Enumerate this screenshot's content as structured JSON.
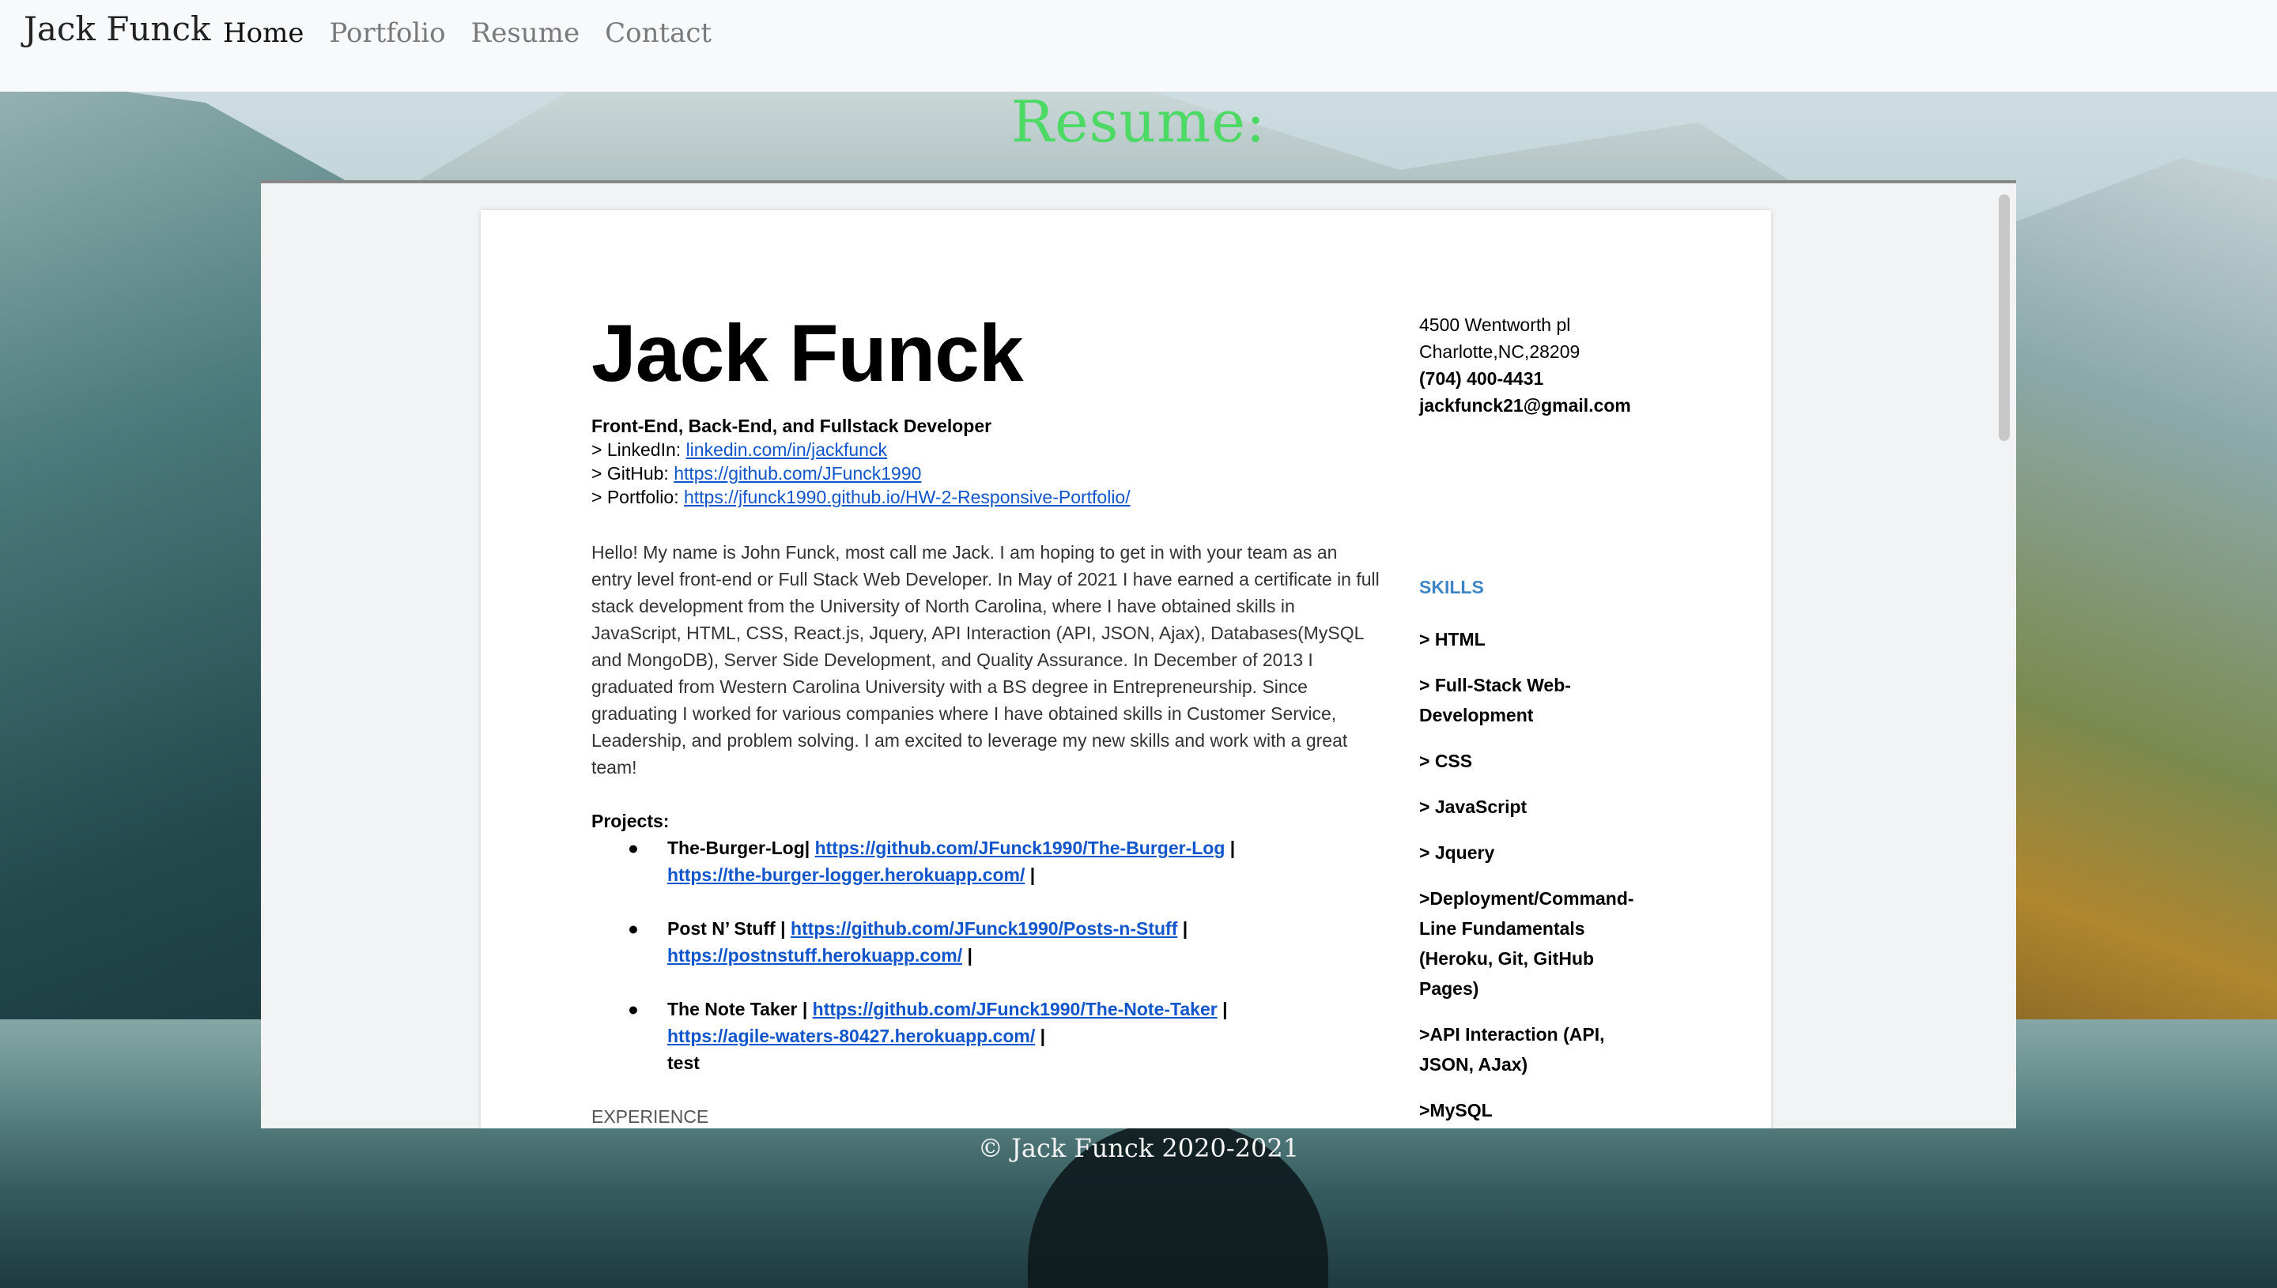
{
  "navbar": {
    "brand": "Jack Funck",
    "links": [
      "Home",
      "Portfolio",
      "Resume",
      "Contact"
    ]
  },
  "page_title": "Resume:",
  "resume": {
    "name": "Jack Funck",
    "tagline": "Front-End, Back-End, and Fullstack Developer",
    "linkedin_label": "> LinkedIn: ",
    "linkedin_url": "linkedin.com/in/jackfunck",
    "github_label": "> GitHub: ",
    "github_url": "https://github.com/JFunck1990",
    "portfolio_label": "> Portfolio: ",
    "portfolio_url": "https://jfunck1990.github.io/HW-2-Responsive-Portfolio/",
    "bio": "Hello! My name is John Funck, most call me Jack. I am hoping to get in with your team as an entry level  front-end or Full Stack  Web Developer. In May of 2021 I have earned a certificate in full stack development from the University of North Carolina, where I have obtained skills in JavaScript, HTML, CSS, React.js, Jquery, API Interaction (API, JSON, Ajax), Databases(MySQL and MongoDB), Server Side Development, and Quality Assurance.  In December of 2013 I graduated from Western Carolina University with a BS degree in Entrepreneurship. Since graduating I worked for various companies where I have obtained skills in Customer Service, Leadership, and problem solving. I am excited to leverage my new skills and work with a great team!",
    "projects_heading": "Projects:",
    "projects": [
      {
        "name": "The-Burger-Log|",
        "repo": "https://github.com/JFunck1990/The-Burger-Log",
        "sep1": "  |",
        "app": "https://the-burger-logger.herokuapp.com/",
        "sep2": " |",
        "extra": ""
      },
      {
        "name": "Post N’ Stuff  |",
        "repo": "https://github.com/JFunck1990/Posts-n-Stuff",
        "sep1": " |",
        "app": "https://postnstuff.herokuapp.com/",
        "sep2": " |",
        "extra": ""
      },
      {
        "name": "The Note Taker |",
        "repo": "https://github.com/JFunck1990/The-Note-Taker",
        "sep1": " |",
        "app": "https://agile-waters-80427.herokuapp.com/",
        "sep2": " |",
        "extra": "test"
      }
    ],
    "experience_heading": "EXPERIENCE",
    "address_line1": "4500 Wentworth pl",
    "address_line2": "Charlotte,NC,28209",
    "phone": "(704) 400-4431",
    "email": "jackfunck21@gmail.com",
    "skills_heading": "SKILLS",
    "skills": [
      "> HTML",
      "> Full-Stack Web-Development",
      "> CSS",
      "> JavaScript",
      "> Jquery",
      ">Deployment/Command-Line Fundamentals (Heroku, Git, GitHub Pages)",
      ">API Interaction (API, JSON, AJax)",
      ">MySQL"
    ]
  },
  "footer": "© Jack Funck 2020-2021",
  "colors": {
    "title_green": "#4cd964",
    "link_blue": "#1155cc",
    "skills_blue": "#3d85c6",
    "navbar_bg": "#f8f9fa"
  }
}
